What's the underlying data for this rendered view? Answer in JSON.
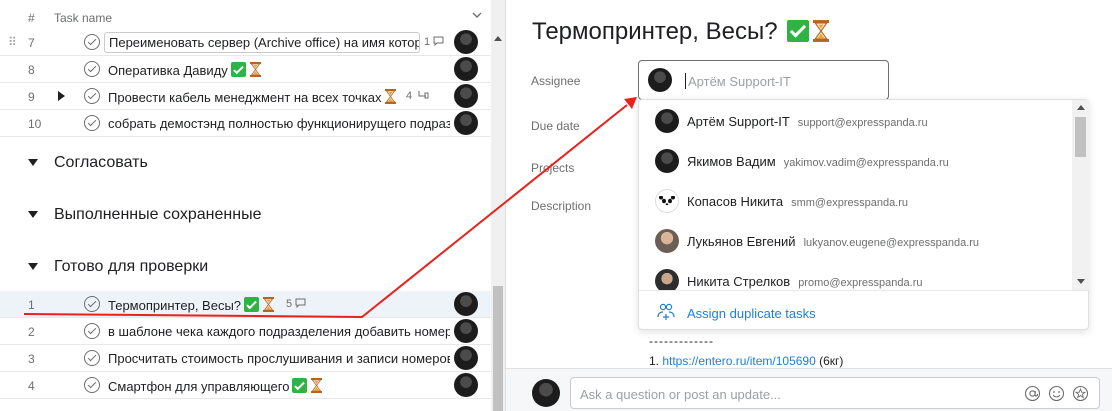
{
  "list_header": {
    "num": "#",
    "task_name": "Task name"
  },
  "rows_top": [
    {
      "n": "7",
      "text": "Переименовать сервер (Archive office) на имя котор",
      "meta": "1"
    },
    {
      "n": "8",
      "text": "Оперативка Давиду"
    },
    {
      "n": "9",
      "text": "Провести кабель менеджмент на всех точках",
      "meta": "4"
    },
    {
      "n": "10",
      "text": "собрать демостэнд полностью функционирущего подраз"
    }
  ],
  "sections": [
    "Согласовать",
    "Выполненные сохраненные",
    "Готово для проверки"
  ],
  "rows_bottom": [
    {
      "n": "1",
      "text": "Термопринтер, Весы?",
      "meta": "5"
    },
    {
      "n": "2",
      "text": "в шаблоне чека каждого подразделения добавить номер"
    },
    {
      "n": "3",
      "text": "Просчитать стоимость прослушивания и записи номеров"
    },
    {
      "n": "4",
      "text": "Смартфон для управляющего"
    }
  ],
  "detail": {
    "title": "Термопринтер, Весы?",
    "labels": {
      "assignee": "Assignee",
      "due_date": "Due date",
      "projects": "Projects",
      "description": "Description"
    },
    "assignee_placeholder": "Артём Support-IT",
    "options": [
      {
        "name": "Артём Support-IT",
        "email": "support@expresspanda.ru"
      },
      {
        "name": "Якимов Вадим",
        "email": "yakimov.vadim@expresspanda.ru"
      },
      {
        "name": "Копасов Никита",
        "email": "smm@expresspanda.ru"
      },
      {
        "name": "Лукьянов Евгений",
        "email": "lukyanov.eugene@expresspanda.ru"
      },
      {
        "name": "Никита Стрелков",
        "email": "promo@expresspanda.ru"
      }
    ],
    "assign_duplicate": "Assign duplicate tasks",
    "desc_separator": "-------------",
    "desc_item_prefix": "1. ",
    "desc_link": "https://entero.ru/item/105690",
    "desc_suffix": " (6кг)",
    "comment_placeholder": "Ask a question or post an update..."
  },
  "colors": {
    "accent_blue": "#1f7ed2",
    "annotation_red": "#e8221b",
    "check_green": "#2fb344"
  },
  "icons": [
    "chevron-down-icon",
    "drag-handle-icon",
    "check-circle-icon",
    "comment-icon",
    "subtask-icon",
    "hourglass-icon",
    "check-mark-emoji-icon",
    "assign-duplicate-icon",
    "mention-icon",
    "emoji-icon",
    "star-icon"
  ]
}
